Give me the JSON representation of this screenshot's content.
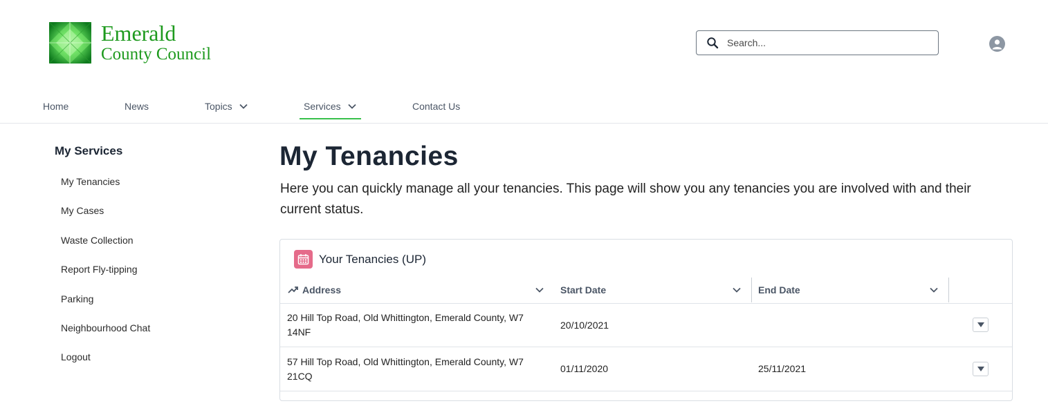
{
  "header": {
    "brand_line1": "Emerald",
    "brand_line2": "County Council",
    "search_placeholder": "Search..."
  },
  "nav": {
    "items": [
      {
        "label": "Home"
      },
      {
        "label": "News"
      },
      {
        "label": "Topics"
      },
      {
        "label": "Services"
      },
      {
        "label": "Contact Us"
      }
    ],
    "active": "Services"
  },
  "sidebar": {
    "title": "My Services",
    "items": [
      {
        "label": "My Tenancies"
      },
      {
        "label": "My Cases"
      },
      {
        "label": "Waste Collection"
      },
      {
        "label": "Report Fly-tipping"
      },
      {
        "label": "Parking"
      },
      {
        "label": "Neighbourhood Chat"
      },
      {
        "label": "Logout"
      }
    ]
  },
  "main": {
    "title": "My Tenancies",
    "intro": "Here you can quickly manage all your tenancies. This page will show you any tenancies you are involved with and their current status.",
    "card": {
      "title": "Your Tenancies (UP)",
      "columns": [
        "Address",
        "Start Date",
        "End Date"
      ],
      "rows": [
        {
          "address": "20 Hill Top Road, Old Whittington, Emerald County, W7 14NF",
          "start": "20/10/2021",
          "end": ""
        },
        {
          "address": "57 Hill Top Road, Old Whittington, Emerald County, W7 21CQ",
          "start": "01/11/2020",
          "end": "25/11/2021"
        }
      ]
    }
  },
  "colors": {
    "brand_green": "#1e9a1e",
    "nav_active_underline": "#37c04a",
    "card_icon_bg": "#e56b8a",
    "heading": "#1c2634"
  },
  "icons": [
    "emerald-logo",
    "search-icon",
    "user-avatar-icon",
    "chevron-down-icon",
    "calendar-icon",
    "trend-icon",
    "dropdown-triangle-icon"
  ]
}
